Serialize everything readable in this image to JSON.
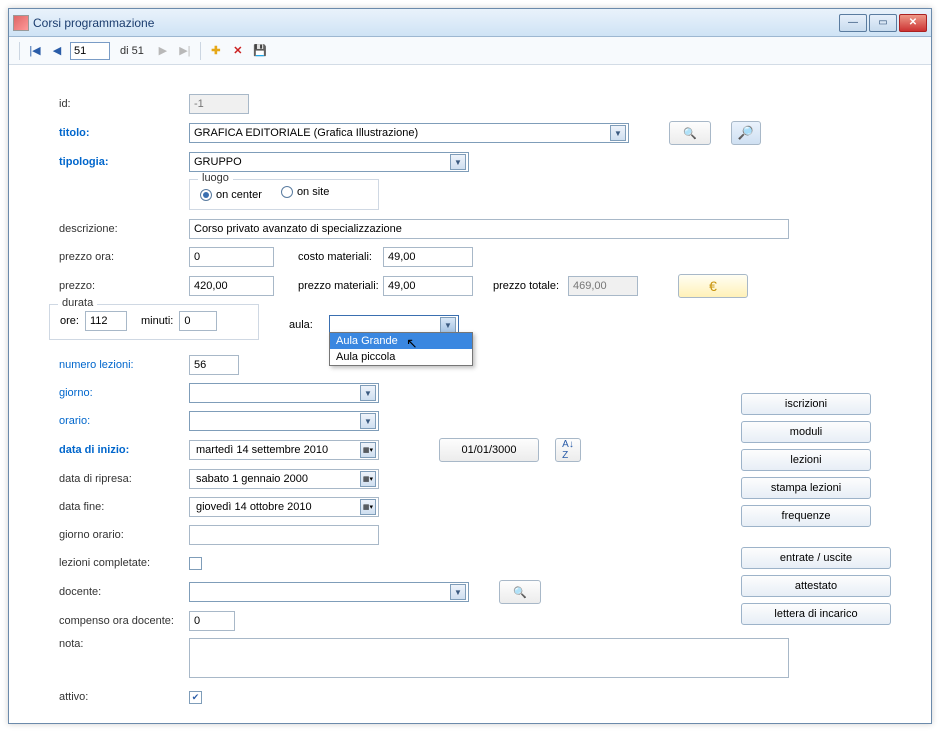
{
  "window": {
    "title": "Corsi programmazione"
  },
  "navigator": {
    "current": "51",
    "total_label": "di 51"
  },
  "labels": {
    "id": "id:",
    "titolo": "titolo:",
    "tipologia": "tipologia:",
    "luogo": "luogo",
    "on_center": "on center",
    "on_site": "on site",
    "descrizione": "descrizione:",
    "prezzo_ora": "prezzo ora:",
    "costo_materiali": "costo materiali:",
    "prezzo": "prezzo:",
    "prezzo_materiali": "prezzo materiali:",
    "prezzo_totale": "prezzo totale:",
    "durata": "durata",
    "ore": "ore:",
    "minuti": "minuti:",
    "aula": "aula:",
    "numero_lezioni": "numero lezioni:",
    "giorno": "giorno:",
    "orario": "orario:",
    "data_inizio": "data di inizio:",
    "data_ripresa": "data di ripresa:",
    "data_fine": "data fine:",
    "giorno_orario": "giorno orario:",
    "lezioni_completate": "lezioni completate:",
    "docente": "docente:",
    "compenso_ora_docente": "compenso ora docente:",
    "nota": "nota:",
    "attivo": "attivo:"
  },
  "values": {
    "id": "-1",
    "titolo": "GRAFICA EDITORIALE (Grafica Illustrazione)",
    "tipologia": "GRUPPO",
    "descrizione": "Corso privato avanzato di specializzazione",
    "prezzo_ora": "0",
    "costo_materiali": "49,00",
    "prezzo": "420,00",
    "prezzo_materiali": "49,00",
    "prezzo_totale": "469,00",
    "ore": "112",
    "minuti": "0",
    "aula_options": [
      "Aula Grande",
      "Aula piccola"
    ],
    "numero_lezioni": "56",
    "data_inizio": "martedì   14  settembre  2010",
    "data_ripresa": "sabato     1   gennaio     2000",
    "data_fine": "giovedì   14   ottobre    2010",
    "date_button": "01/01/3000",
    "compenso": "0",
    "attivo": true
  },
  "buttons": {
    "iscrizioni": "iscrizioni",
    "moduli": "moduli",
    "lezioni": "lezioni",
    "stampa_lezioni": "stampa lezioni",
    "frequenze": "frequenze",
    "entrate_uscite": "entrate / uscite",
    "attestato": "attestato",
    "lettera": "lettera di incarico",
    "euro": "€"
  }
}
